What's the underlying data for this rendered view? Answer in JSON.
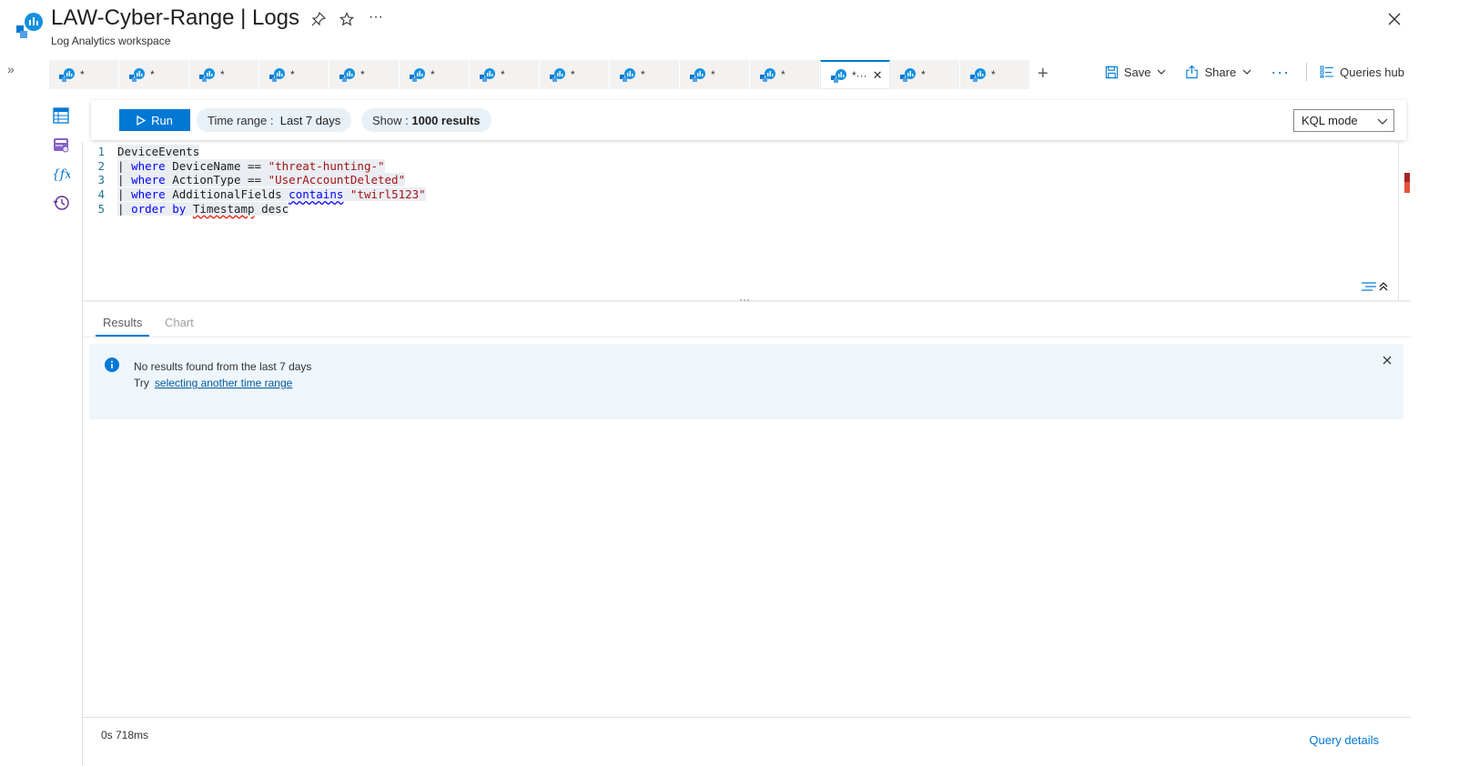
{
  "header": {
    "title": "LAW-Cyber-Range | Logs",
    "subtitle": "Log Analytics workspace",
    "more": "···"
  },
  "tabs": [
    {
      "label": "*"
    },
    {
      "label": "*"
    },
    {
      "label": "*"
    },
    {
      "label": "*"
    },
    {
      "label": "*"
    },
    {
      "label": "*"
    },
    {
      "label": "*"
    },
    {
      "label": "*"
    },
    {
      "label": "*"
    },
    {
      "label": "*"
    },
    {
      "label": "*"
    },
    {
      "label": "*···",
      "active": true
    },
    {
      "label": "*"
    },
    {
      "label": "*"
    }
  ],
  "toolbar": {
    "save_label": "Save",
    "share_label": "Share",
    "more_label": "···",
    "queries_hub_label": "Queries hub",
    "add_tab": "+",
    "expand": "»"
  },
  "query_bar": {
    "run_label": "Run",
    "time_range_prefix": "Time range :",
    "time_range_value": "Last 7 days",
    "show_prefix": "Show :",
    "show_value": "1000 results",
    "mode": "KQL mode"
  },
  "editor": {
    "line_numbers": [
      "1",
      "2",
      "3",
      "4",
      "5"
    ],
    "lines": [
      {
        "parts": [
          {
            "t": "DeviceEvents",
            "c": ""
          }
        ]
      },
      {
        "parts": [
          {
            "t": "| ",
            "c": ""
          },
          {
            "t": "where",
            "c": "kw"
          },
          {
            "t": " DeviceName == ",
            "c": ""
          },
          {
            "t": "\"threat-hunting-\"",
            "c": "str"
          }
        ]
      },
      {
        "parts": [
          {
            "t": "| ",
            "c": ""
          },
          {
            "t": "where",
            "c": "kw"
          },
          {
            "t": " ActionType == ",
            "c": ""
          },
          {
            "t": "\"UserAccountDeleted\"",
            "c": "str"
          }
        ]
      },
      {
        "parts": [
          {
            "t": "| ",
            "c": ""
          },
          {
            "t": "where",
            "c": "kw"
          },
          {
            "t": " AdditionalFields ",
            "c": ""
          },
          {
            "t": "contains",
            "c": "kw squig-b"
          },
          {
            "t": " ",
            "c": ""
          },
          {
            "t": "\"twirl5123\"",
            "c": "str"
          }
        ]
      },
      {
        "parts": [
          {
            "t": "| ",
            "c": ""
          },
          {
            "t": "order by",
            "c": "kw"
          },
          {
            "t": " ",
            "c": ""
          },
          {
            "t": "Timestamp",
            "c": "squig"
          },
          {
            "t": " desc",
            "c": ""
          }
        ]
      }
    ],
    "splitter": "···"
  },
  "results": {
    "tab_results": "Results",
    "tab_chart": "Chart",
    "message_line1": "No results found from the last 7 days",
    "message_try": "Try",
    "message_link": "selecting another time range",
    "timing": "0s 718ms",
    "query_details": "Query details"
  },
  "colors": {
    "accent": "#0078d4",
    "info_bg": "#eff6fc",
    "keyword": "#0000ff",
    "string": "#a31515"
  }
}
